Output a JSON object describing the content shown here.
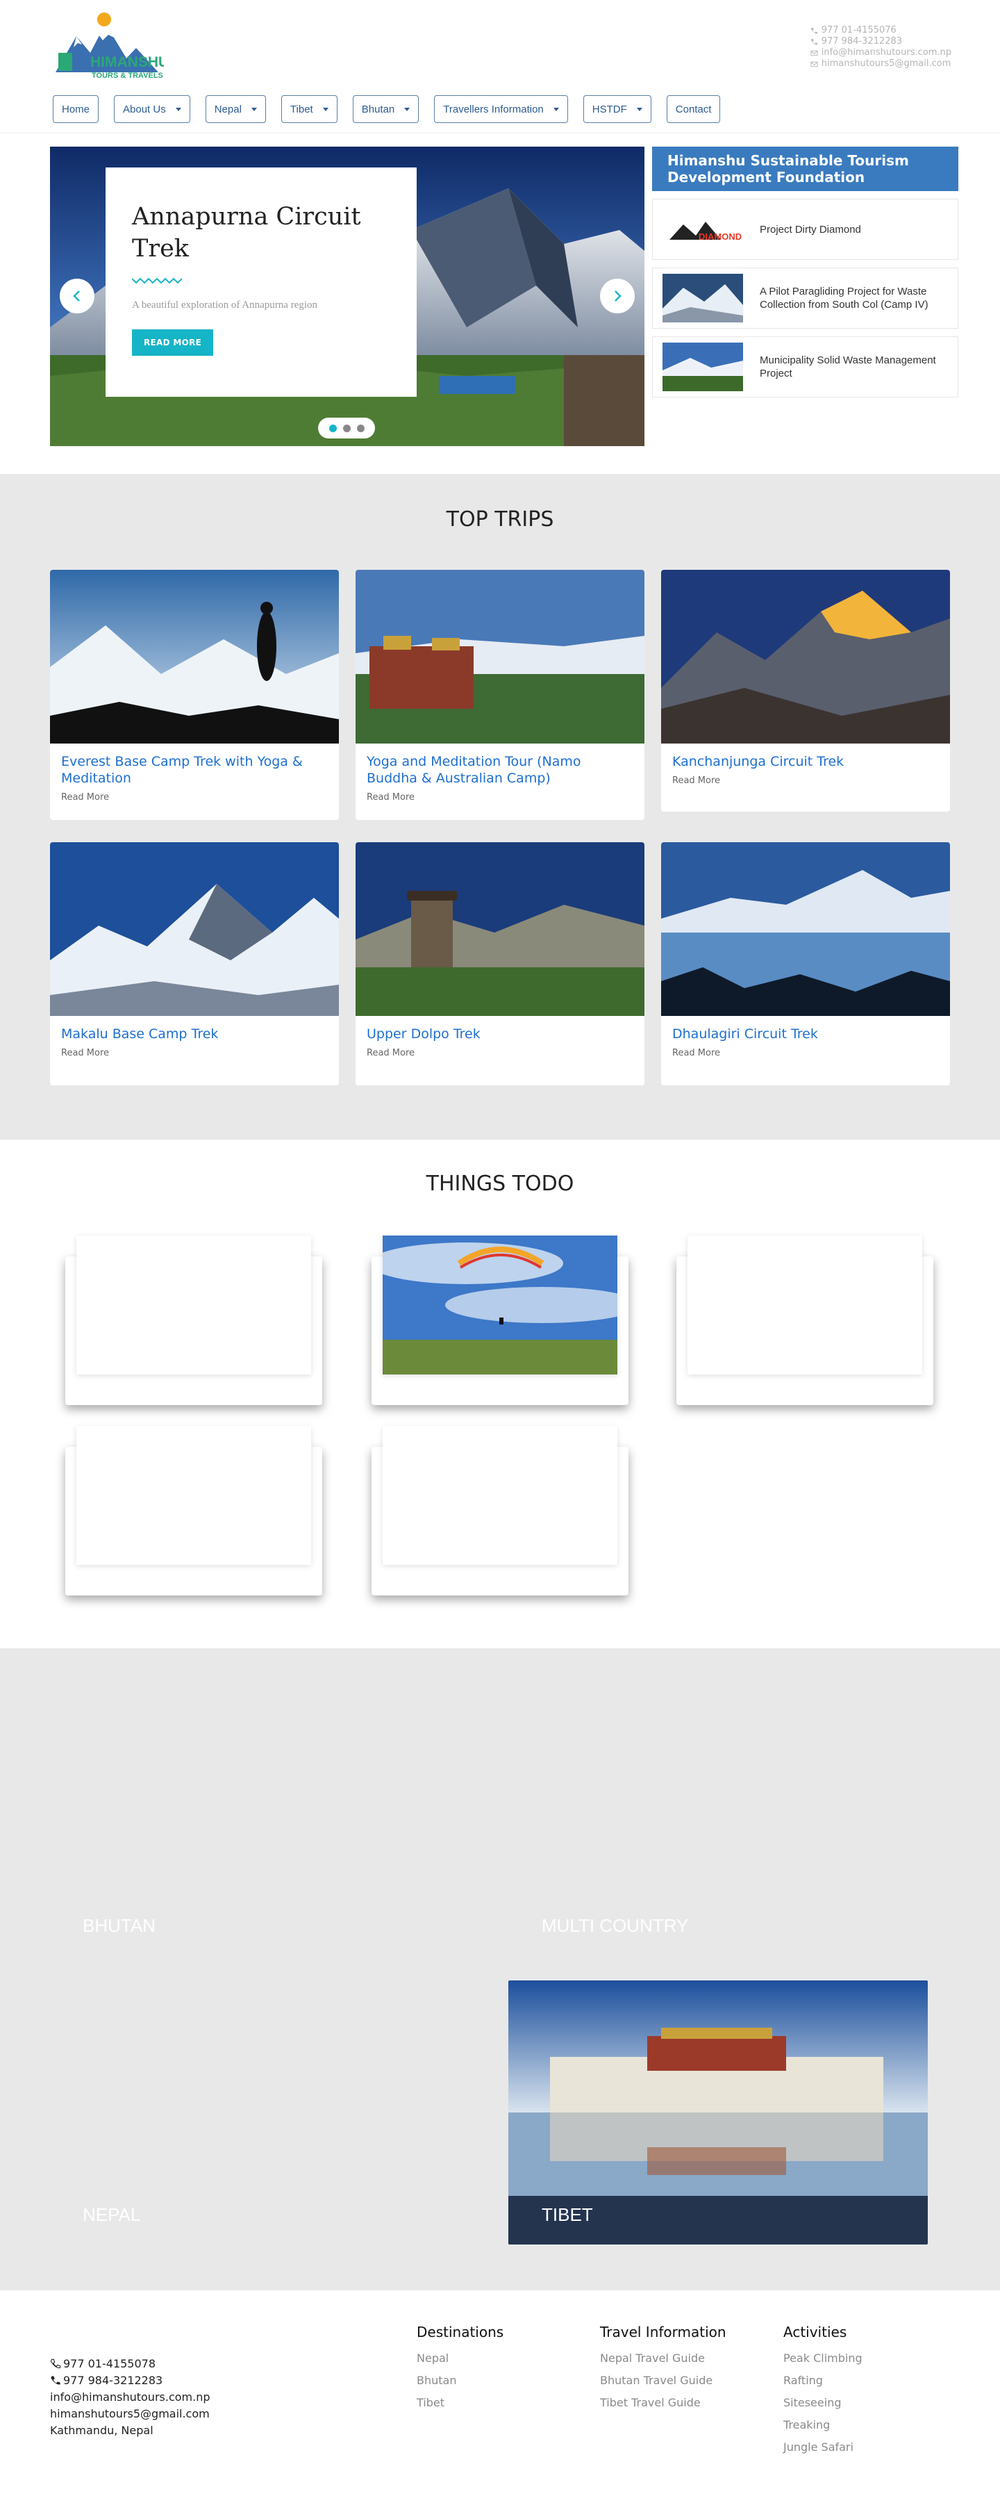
{
  "header": {
    "contact": {
      "phone1": "977 01-4155076",
      "phone2": "977 984-3212283",
      "email1": "info@himanshutours.com.np",
      "email2": "himanshutours5@gmail.com"
    },
    "nav": [
      {
        "label": "Home",
        "dropdown": false
      },
      {
        "label": "About Us",
        "dropdown": true
      },
      {
        "label": "Nepal",
        "dropdown": true
      },
      {
        "label": "Tibet",
        "dropdown": true
      },
      {
        "label": "Bhutan",
        "dropdown": true
      },
      {
        "label": "Travellers Information",
        "dropdown": true
      },
      {
        "label": "HSTDF",
        "dropdown": true
      },
      {
        "label": "Contact",
        "dropdown": false
      }
    ],
    "logo": {
      "line1": "HIMANSHU",
      "line2": "TOURS & TRAVELS"
    }
  },
  "hero": {
    "title": "Annapurna Circuit Trek",
    "subtitle": "A beautiful exploration of Annapurna region",
    "button": "READ MORE"
  },
  "side": {
    "heading": "Himanshu Sustainable Tourism Development Foundation",
    "items": [
      {
        "title": "Project Dirty Diamond",
        "thumb_text": "DIAMOND"
      },
      {
        "title": "A Pilot Paragliding Project for Waste Collection from South Col (Camp IV)"
      },
      {
        "title": "Municipality Solid Waste Management Project"
      }
    ]
  },
  "top_trips": {
    "title": "TOP TRIPS",
    "read_more": "Read More",
    "items": [
      {
        "title": "Everest Base Camp Trek with Yoga & Meditation"
      },
      {
        "title": "Yoga and Meditation Tour (Namo Buddha & Australian Camp)"
      },
      {
        "title": "Kanchanjunga Circuit Trek"
      },
      {
        "title": "Makalu Base Camp Trek"
      },
      {
        "title": "Upper Dolpo Trek"
      },
      {
        "title": "Dhaulagiri Circuit Trek"
      }
    ]
  },
  "things_todo": {
    "title": "THINGS TODO"
  },
  "destinations": {
    "bhutan": "BHUTAN",
    "multi": "MULTI COUNTRY",
    "nepal": "NEPAL",
    "tibet": "TIBET"
  },
  "footer": {
    "contact": {
      "phone1": "977 01-4155078",
      "phone2": "977 984-3212283",
      "email1": "info@himanshutours.com.np",
      "email2": "himanshutours5@gmail.com",
      "address": "Kathmandu, Nepal"
    },
    "destinations": {
      "title": "Destinations",
      "links": [
        "Nepal",
        "Bhutan",
        "Tibet"
      ]
    },
    "travel_info": {
      "title": "Travel Information",
      "links": [
        "Nepal Travel Guide",
        "Bhutan Travel Guide",
        "Tibet Travel Guide"
      ]
    },
    "activities": {
      "title": "Activities",
      "links": [
        "Peak Climbing",
        "Rafting",
        "Siteseeing",
        "Treaking",
        "Jungle Safari"
      ]
    }
  },
  "colors": {
    "accent": "#16b4c7",
    "nav": "#2e5b92",
    "panel": "#3a7bbf",
    "link": "#1d6fcf",
    "bg_gray": "#e8e8e9"
  }
}
